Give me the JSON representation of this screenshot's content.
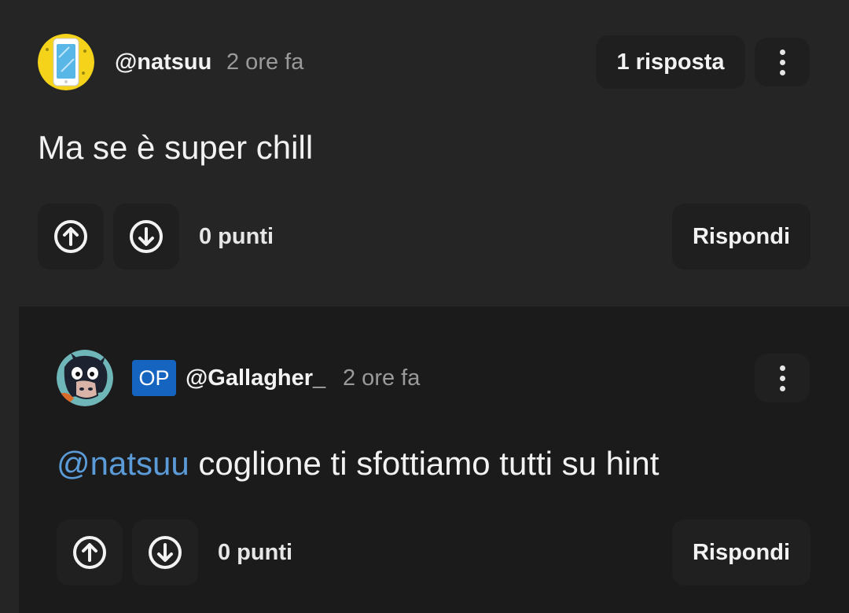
{
  "comment": {
    "username": "@natsuu",
    "time": "2 ore fa",
    "replies_label": "1 risposta",
    "text": "Ma se è super chill",
    "points_label": "0 punti",
    "reply_label": "Rispondi",
    "avatar_icon": "phone-avatar-icon"
  },
  "reply": {
    "badge": "OP",
    "username": "@Gallagher_",
    "time": "2 ore fa",
    "mention": "@natsuu",
    "text": " coglione ti sfottiamo tutti su hint",
    "points_label": "0 punti",
    "reply_label": "Rispondi",
    "avatar_icon": "cartoon-cow-avatar-icon"
  },
  "colors": {
    "background": "#1b1b1c",
    "card": "#252526",
    "mention": "#5b9bd8",
    "op_badge": "#1565c0"
  }
}
